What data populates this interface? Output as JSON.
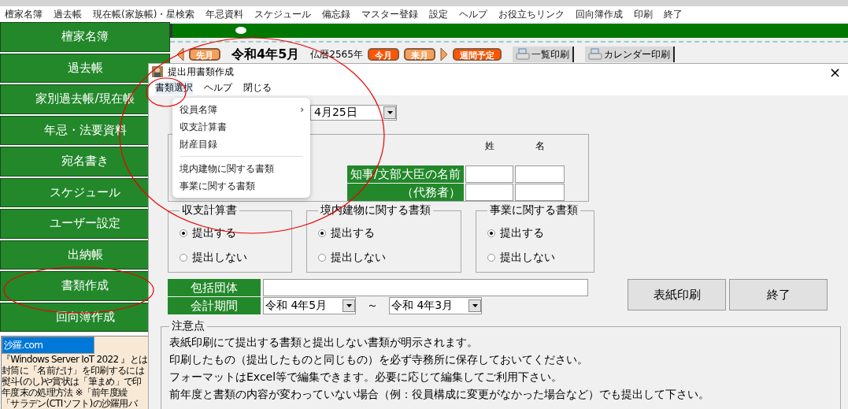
{
  "menu_bar": [
    "檀家名簿",
    "過去帳",
    "現在帳(家族帳)・星検索",
    "年忌資料",
    "スケジュール",
    "備忘録",
    "マスター登録",
    "設定",
    "ヘルプ",
    "お役立ちリンク",
    "回向簿作成",
    "印刷",
    "終了"
  ],
  "sidebar": {
    "items": [
      "檀家名簿",
      "過去帳",
      "家別過去帳/現在帳",
      "年忌・法要資料",
      "宛名書き",
      "スケジュール",
      "ユーザー設定",
      "出納帳",
      "書類作成",
      "回向簿作成"
    ],
    "news": [
      {
        "text": "沙羅.com",
        "selected": true
      },
      {
        "text": "『Windows Server IoT 2022 』とは",
        "selected": false
      },
      {
        "text": "封筒に「名前だけ」を印刷するには",
        "selected": false
      },
      {
        "text": "熨斗(のし)や賞状は「筆まめ」で印",
        "selected": false
      },
      {
        "text": "年度末の処理方法 ※「前年度繰",
        "selected": false
      },
      {
        "text": "「サラデン(CTIソフト)の沙羅用バ",
        "selected": false
      }
    ]
  },
  "calendar_toolbar": {
    "prev": "先月",
    "month": "令和4年5月",
    "buddhist_year": "仏暦2565年",
    "today": "今月",
    "next": "来月",
    "weekly": "週間予定",
    "print_buttons": [
      "一覧印刷",
      "カレンダー印刷"
    ]
  },
  "dialog": {
    "title": "提出用書類作成",
    "close": "×",
    "menu": [
      {
        "label": "書類選択",
        "open": true
      },
      {
        "label": "ヘルプ",
        "open": false
      },
      {
        "label": "閉じる",
        "open": false
      }
    ],
    "dropdown": [
      {
        "kind": "submenu",
        "label": "役員名簿",
        "submenu_mark": "›"
      },
      {
        "kind": "item",
        "label": "収支計算書"
      },
      {
        "kind": "item",
        "label": "財産目録"
      },
      {
        "kind": "separator"
      },
      {
        "kind": "item",
        "label": "境内建物に関する書類"
      },
      {
        "kind": "item",
        "label": "事業に関する書類"
      }
    ],
    "date": "4月25日",
    "name_table": {
      "headers": [
        "姓",
        "名"
      ],
      "label_lines": [
        "知事/文部大臣の名前",
        "（代務者）"
      ]
    },
    "radio_groups": [
      {
        "title": "収支計算書",
        "options": [
          {
            "label": "提出する",
            "selected": true
          },
          {
            "label": "提出しない",
            "selected": false
          }
        ]
      },
      {
        "title": "境内建物に関する書類",
        "options": [
          {
            "label": "提出する",
            "selected": true
          },
          {
            "label": "提出しない",
            "selected": false
          }
        ]
      },
      {
        "title": "事業に関する書類",
        "options": [
          {
            "label": "提出する",
            "selected": true
          },
          {
            "label": "提出しない",
            "selected": false
          }
        ]
      }
    ],
    "umbrella": {
      "label": "包括団体"
    },
    "period": {
      "label": "会計期間",
      "from": "令和 4年5月",
      "separator": "～",
      "to": "令和 4年3月"
    },
    "buttons": [
      "表紙印刷",
      "終了"
    ],
    "notes": {
      "title": "注意点",
      "lines": [
        "表紙印刷にて提出する書類と提出しない書類が明示されます。",
        "印刷したもの（提出したものと同じもの）を必ず寺務所に保存しておいてください。",
        "フォーマットはExcel等で編集できます。必要に応じて編集してご利用下さい。",
        "前年度と書類の内容が変わっていない場合（例：役員構成に変更がなかった場合など）でも提出して下さい。"
      ]
    }
  }
}
